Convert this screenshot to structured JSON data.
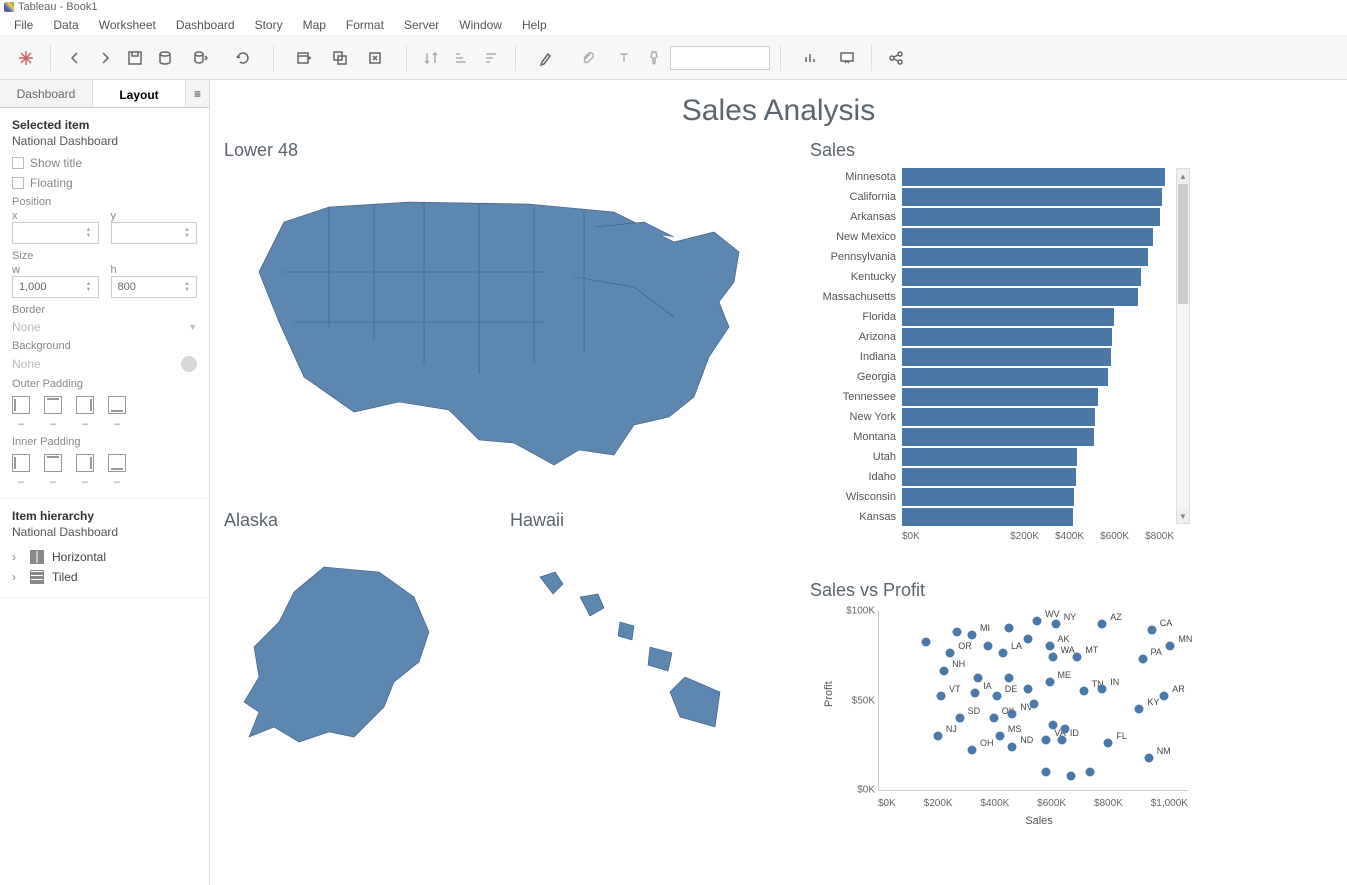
{
  "window": {
    "title": "Tableau - Book1"
  },
  "menu": [
    "File",
    "Data",
    "Worksheet",
    "Dashboard",
    "Story",
    "Map",
    "Format",
    "Server",
    "Window",
    "Help"
  ],
  "side": {
    "tabs": [
      "Dashboard",
      "Layout"
    ],
    "active_tab": "Layout",
    "selected_heading": "Selected item",
    "selected_item": "National Dashboard",
    "show_title": "Show title",
    "floating": "Floating",
    "position_label": "Position",
    "x_label": "x",
    "y_label": "y",
    "x_val": "",
    "y_val": "",
    "size_label": "Size",
    "w_label": "w",
    "h_label": "h",
    "w_val": "1,000",
    "h_val": "800",
    "border_label": "Border",
    "border_val": "None",
    "background_label": "Background",
    "background_val": "None",
    "outer_label": "Outer Padding",
    "inner_label": "Inner Padding",
    "hierarchy_heading": "Item hierarchy",
    "hierarchy_root": "National Dashboard",
    "hier1": "Horizontal",
    "hier2": "Tiled"
  },
  "dash": {
    "title": "Sales Analysis",
    "lower48": "Lower 48",
    "alaska": "Alaska",
    "hawaii": "Hawaii",
    "sales": "Sales",
    "svp": "Sales vs Profit"
  },
  "chart_data": [
    {
      "type": "bar",
      "title": "Sales",
      "xlabel": "",
      "ylabel": "",
      "x_ticks": [
        "$0K",
        "$200K",
        "$400K",
        "$600K",
        "$800K"
      ],
      "xlim": [
        0,
        900
      ],
      "categories": [
        "Minnesota",
        "California",
        "Arkansas",
        "New Mexico",
        "Pennsylvania",
        "Kentucky",
        "Massachusetts",
        "Florida",
        "Arizona",
        "Indiana",
        "Georgia",
        "Tennessee",
        "New York",
        "Montana",
        "Utah",
        "Idaho",
        "Wisconsin",
        "Kansas"
      ],
      "values": [
        870,
        860,
        855,
        830,
        815,
        790,
        780,
        700,
        695,
        690,
        680,
        650,
        640,
        635,
        580,
        575,
        570,
        565
      ]
    },
    {
      "type": "scatter",
      "title": "Sales vs Profit",
      "xlabel": "Sales",
      "ylabel": "Profit",
      "xlim": [
        0,
        1000
      ],
      "ylim": [
        0,
        100
      ],
      "x_ticks": [
        "$0K",
        "$200K",
        "$400K",
        "$600K",
        "$800K",
        "$1,000K"
      ],
      "y_ticks": [
        "$0K",
        "$50K",
        "$100K"
      ],
      "points": [
        {
          "l": "WV",
          "x": 510,
          "y": 94
        },
        {
          "l": "NY",
          "x": 570,
          "y": 92
        },
        {
          "l": "AZ",
          "x": 720,
          "y": 92
        },
        {
          "l": "CA",
          "x": 880,
          "y": 89
        },
        {
          "l": "MI",
          "x": 300,
          "y": 86
        },
        {
          "l": "AK",
          "x": 550,
          "y": 80
        },
        {
          "l": "MN",
          "x": 940,
          "y": 80
        },
        {
          "l": "OR",
          "x": 230,
          "y": 76
        },
        {
          "l": "LA",
          "x": 400,
          "y": 76
        },
        {
          "l": "WA",
          "x": 560,
          "y": 74
        },
        {
          "l": "MT",
          "x": 640,
          "y": 74
        },
        {
          "l": "PA",
          "x": 850,
          "y": 73
        },
        {
          "l": "NH",
          "x": 210,
          "y": 66
        },
        {
          "l": "ME",
          "x": 550,
          "y": 60
        },
        {
          "l": "VT",
          "x": 200,
          "y": 52
        },
        {
          "l": "IA",
          "x": 310,
          "y": 54
        },
        {
          "l": "DE",
          "x": 380,
          "y": 52
        },
        {
          "l": "TN",
          "x": 660,
          "y": 55
        },
        {
          "l": "IN",
          "x": 720,
          "y": 56
        },
        {
          "l": "AR",
          "x": 920,
          "y": 52
        },
        {
          "l": "KY",
          "x": 840,
          "y": 45
        },
        {
          "l": "SD",
          "x": 260,
          "y": 40
        },
        {
          "l": "OK",
          "x": 370,
          "y": 40
        },
        {
          "l": "NV",
          "x": 430,
          "y": 42
        },
        {
          "l": "NJ",
          "x": 190,
          "y": 30
        },
        {
          "l": "MS",
          "x": 390,
          "y": 30
        },
        {
          "l": "VA",
          "x": 540,
          "y": 28
        },
        {
          "l": "ID",
          "x": 590,
          "y": 28
        },
        {
          "l": "FL",
          "x": 740,
          "y": 26
        },
        {
          "l": "OH",
          "x": 300,
          "y": 22
        },
        {
          "l": "ND",
          "x": 430,
          "y": 24
        },
        {
          "l": "NM",
          "x": 870,
          "y": 18
        },
        {
          "l": "",
          "x": 150,
          "y": 82
        },
        {
          "l": "",
          "x": 250,
          "y": 88
        },
        {
          "l": "",
          "x": 350,
          "y": 80
        },
        {
          "l": "",
          "x": 420,
          "y": 90
        },
        {
          "l": "",
          "x": 480,
          "y": 84
        },
        {
          "l": "",
          "x": 320,
          "y": 62
        },
        {
          "l": "",
          "x": 420,
          "y": 62
        },
        {
          "l": "",
          "x": 480,
          "y": 56
        },
        {
          "l": "",
          "x": 500,
          "y": 48
        },
        {
          "l": "",
          "x": 560,
          "y": 36
        },
        {
          "l": "",
          "x": 600,
          "y": 34
        },
        {
          "l": "",
          "x": 540,
          "y": 10
        },
        {
          "l": "",
          "x": 620,
          "y": 8
        },
        {
          "l": "",
          "x": 680,
          "y": 10
        }
      ]
    }
  ]
}
